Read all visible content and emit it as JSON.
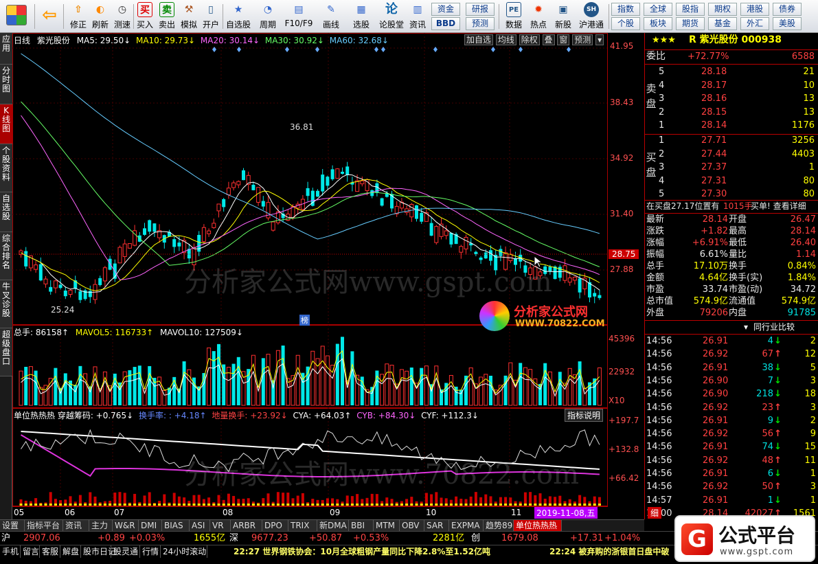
{
  "toolbar": {
    "buttons": [
      {
        "label": "",
        "icon": "app-grid-icon"
      },
      {
        "label": "",
        "icon": "back-arrow-icon"
      },
      {
        "label": "修正",
        "icon": "up-arrow-icon"
      },
      {
        "label": "刷新",
        "icon": "refresh-icon"
      },
      {
        "label": "测速",
        "icon": "clock-icon"
      },
      {
        "label": "买入",
        "icon": "buy-icon",
        "glyph": "买"
      },
      {
        "label": "卖出",
        "icon": "sell-icon",
        "glyph": "卖"
      },
      {
        "label": "模拟",
        "icon": "hammer-icon"
      },
      {
        "label": "开户",
        "icon": "door-icon"
      },
      {
        "label": "自选股",
        "icon": "star-icon"
      },
      {
        "label": "周期",
        "icon": "cycle-icon"
      },
      {
        "label": "F10/F9",
        "icon": "f10-icon"
      },
      {
        "label": "画线",
        "icon": "pen-icon"
      },
      {
        "label": "选股",
        "icon": "filter-icon"
      },
      {
        "label": "论股堂",
        "icon": "chat-icon",
        "glyph": "论"
      },
      {
        "label": "资讯",
        "icon": "news-icon"
      },
      {
        "label": "数据",
        "icon": "data-icon",
        "glyph": "PE"
      },
      {
        "label": "热点",
        "icon": "hot-icon"
      },
      {
        "label": "新股",
        "icon": "new-stock-icon"
      },
      {
        "label": "沪港通",
        "icon": "hk-connect-icon"
      }
    ],
    "mid_buttons": [
      "资金",
      "研报",
      "BBD",
      "预测"
    ],
    "right_buttons": [
      "指数",
      "全球",
      "股指",
      "期权",
      "港股",
      "债券",
      "个股",
      "板块",
      "期货",
      "基金",
      "外汇",
      "美股"
    ]
  },
  "left_tabs": [
    "应用",
    "分时图",
    "K线图",
    "个股资料",
    "自选股",
    "综合排名",
    "牛叉诊股",
    "超级盘口"
  ],
  "chart_header": {
    "period": "日线",
    "stock": "紫光股份",
    "ma": [
      {
        "label": "MA5: 29.50↓",
        "color": "#ffffff"
      },
      {
        "label": "MA10: 29.73↓",
        "color": "#ffff00"
      },
      {
        "label": "MA20: 30.14↓",
        "color": "#ff66ff"
      },
      {
        "label": "MA30: 30.92↓",
        "color": "#66ff66"
      },
      {
        "label": "MA60: 32.68↓",
        "color": "#66ccff"
      }
    ],
    "tools": [
      "加自选",
      "均线",
      "除权",
      "叠",
      "窗",
      "预测"
    ]
  },
  "price_axis": [
    "41.95",
    "38.43",
    "34.92",
    "31.40",
    "27.88"
  ],
  "current_price_tag": "28.75",
  "annotations": {
    "high": "36.81",
    "low": "25.24",
    "marker": "榜"
  },
  "volume_panel": {
    "header": [
      {
        "label": "总手: 86158↑",
        "color": "#ffffff"
      },
      {
        "label": "MAVOL5: 116733↑",
        "color": "#ffff00"
      },
      {
        "label": "MAVOL10: 127509↓",
        "color": "#ffffff"
      }
    ],
    "axis": [
      "45396",
      "22932",
      "X10"
    ]
  },
  "indicator_panel": {
    "header": [
      {
        "label": "单位热热热 穿越筹码: +0.765↓",
        "color": "#ffffff"
      },
      {
        "label": "换手率: : +4.18↑",
        "color": "#6688ff"
      },
      {
        "label": "地量换手: +23.92↓",
        "color": "#ff4040"
      },
      {
        "label": "CYA: +64.03↑",
        "color": "#ffffff"
      },
      {
        "label": "CYB: +84.30↓",
        "color": "#ff66ff"
      },
      {
        "label": "CYF: +112.3↓",
        "color": "#ffffff"
      }
    ],
    "help_button": "指标说明",
    "axis": [
      "+197.7",
      "+132.8",
      "+66.42"
    ]
  },
  "date_axis": [
    "05",
    "06",
    "07",
    "08",
    "09",
    "10",
    "11"
  ],
  "date_cursor": "2019-11-08,五",
  "watermarks": [
    "分析家公式网www.gspt.com",
    "分析家公式网www.70822.com"
  ],
  "logo_text": {
    "name": "分析家公式网",
    "url": "WWW.70822.COM"
  },
  "quote": {
    "rating": "★★★",
    "title": "R 紫光股份 000938",
    "weibi_label": "委比",
    "weibi": "+72.77%",
    "weicha": "6588",
    "sell_label": "卖盘",
    "buy_label": "买盘",
    "sell": [
      {
        "lvl": "5",
        "price": "28.18",
        "vol": "21"
      },
      {
        "lvl": "4",
        "price": "28.17",
        "vol": "10"
      },
      {
        "lvl": "3",
        "price": "28.16",
        "vol": "13"
      },
      {
        "lvl": "2",
        "price": "28.15",
        "vol": "13"
      },
      {
        "lvl": "1",
        "price": "28.14",
        "vol": "1176"
      }
    ],
    "buy": [
      {
        "lvl": "1",
        "price": "27.71",
        "vol": "3256"
      },
      {
        "lvl": "2",
        "price": "27.44",
        "vol": "4403"
      },
      {
        "lvl": "3",
        "price": "27.37",
        "vol": "1"
      },
      {
        "lvl": "4",
        "price": "27.31",
        "vol": "80"
      },
      {
        "lvl": "5",
        "price": "27.30",
        "vol": "80"
      }
    ],
    "queue": {
      "text": "在买盘27.17位置有",
      "qty": "1015手",
      "tail": "买单! 查看详细"
    },
    "stats": [
      {
        "l1": "最新",
        "v1": "28.14",
        "c1": "red",
        "l2": "开盘",
        "v2": "26.47",
        "c2": "red"
      },
      {
        "l1": "涨跌",
        "v1": "+1.82",
        "c1": "red",
        "l2": "最高",
        "v2": "28.14",
        "c2": "red"
      },
      {
        "l1": "涨幅",
        "v1": "+6.91%",
        "c1": "red",
        "l2": "最低",
        "v2": "26.40",
        "c2": "red"
      },
      {
        "l1": "振幅",
        "v1": "6.61%",
        "c1": "white",
        "l2": "量比",
        "v2": "1.14",
        "c2": "red"
      },
      {
        "l1": "总手",
        "v1": "17.10万",
        "c1": "yellow",
        "l2": "换手",
        "v2": "0.84%",
        "c2": "yellow"
      },
      {
        "l1": "金额",
        "v1": "4.64亿",
        "c1": "yellow",
        "l2": "换手(实)",
        "v2": "1.84%",
        "c2": "yellow"
      },
      {
        "l1": "市盈",
        "v1": "33.74",
        "c1": "white",
        "l2": "市盈(动)",
        "v2": "34.72",
        "c2": "white"
      },
      {
        "l1": "总市值",
        "v1": "574.9亿",
        "c1": "yellow",
        "l2": "流通值",
        "v2": "574.9亿",
        "c2": "yellow"
      },
      {
        "l1": "外盘",
        "v1": "79206",
        "c1": "red",
        "l2": "内盘",
        "v2": "91785",
        "c2": "green"
      }
    ],
    "tick_tabs": [
      "同行业比较"
    ],
    "ticks": [
      {
        "t": "14:56",
        "p": "26.91",
        "v": "4",
        "d": "down",
        "n": "2"
      },
      {
        "t": "14:56",
        "p": "26.92",
        "v": "67",
        "d": "up",
        "n": "12"
      },
      {
        "t": "14:56",
        "p": "26.91",
        "v": "38",
        "d": "down",
        "n": "5"
      },
      {
        "t": "14:56",
        "p": "26.90",
        "v": "7",
        "d": "down",
        "n": "3"
      },
      {
        "t": "14:56",
        "p": "26.90",
        "v": "218",
        "d": "down",
        "n": "18"
      },
      {
        "t": "14:56",
        "p": "26.92",
        "v": "23",
        "d": "up",
        "n": "3"
      },
      {
        "t": "14:56",
        "p": "26.91",
        "v": "9",
        "d": "down",
        "n": "2"
      },
      {
        "t": "14:56",
        "p": "26.92",
        "v": "56",
        "d": "up",
        "n": "9"
      },
      {
        "t": "14:56",
        "p": "26.91",
        "v": "74",
        "d": "down",
        "n": "15"
      },
      {
        "t": "14:56",
        "p": "26.92",
        "v": "48",
        "d": "up",
        "n": "11"
      },
      {
        "t": "14:56",
        "p": "26.91",
        "v": "6",
        "d": "down",
        "n": "1"
      },
      {
        "t": "14:56",
        "p": "26.92",
        "v": "50",
        "d": "up",
        "n": "3"
      },
      {
        "t": "14:57",
        "p": "26.91",
        "v": "1",
        "d": "down",
        "n": "1"
      },
      {
        "t": "15:00",
        "p": "28.14",
        "v": "42027",
        "d": "up",
        "n": "1561"
      }
    ],
    "detail_tab": "细"
  },
  "bottom_tabs": [
    "设置",
    "指标平台",
    "资讯",
    "主力",
    "W&R",
    "DMI",
    "BIAS",
    "ASI",
    "VR",
    "ARBR",
    "DPO",
    "TRIX",
    "新DMA",
    "BBI",
    "MTM",
    "OBV",
    "SAR",
    "EXPMA",
    "趋势89",
    "单位热热热"
  ],
  "index_bar": {
    "sh_label": "沪",
    "sh_val": "2907.06",
    "sh_chg": "+0.89",
    "sh_pct": "+0.03%",
    "sh_amt": "1655亿",
    "sz_label": "深",
    "sz_val": "9677.23",
    "sz_chg": "+50.87",
    "sz_pct": "+0.53%",
    "sz_amt": "2281亿",
    "cy_label": "创",
    "cy_val": "1679.08",
    "cy_chg": "+17.31",
    "cy_pct": "+1.04%"
  },
  "status_bar": {
    "items": [
      "手机",
      "留言",
      "客服",
      "解盘",
      "股市日记",
      "股灵通",
      "行情",
      "24小时滚动"
    ],
    "news1": "22:27 世界钢铁协会：10月全球粗钢产量同比下降2.8%至1.52亿吨",
    "news2": "22:24 被弃购的浙银首日盘中破"
  },
  "brand": {
    "name": "公式平台",
    "url": "www.gspt.com"
  }
}
